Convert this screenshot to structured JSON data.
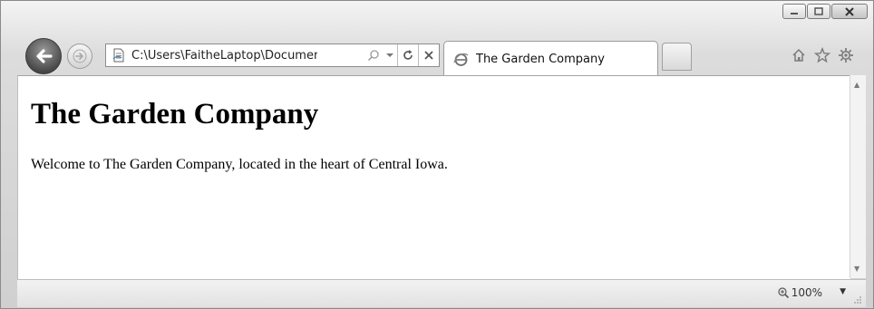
{
  "window": {
    "caption_buttons": [
      "minimize",
      "maximize",
      "close"
    ]
  },
  "nav": {
    "back_icon": "back-arrow-icon",
    "forward_icon": "forward-arrow-icon"
  },
  "address_bar": {
    "url": "C:\\Users\\FaitheLaptop\\Documents\\N",
    "icons": [
      "page-icon",
      "search-icon",
      "dropdown-icon",
      "refresh-icon",
      "stop-icon"
    ]
  },
  "tab": {
    "label": "The Garden Company",
    "icon": "ie-page-icon"
  },
  "toolbar_right": {
    "icons": [
      "home-icon",
      "favorites-star-icon",
      "settings-gear-icon"
    ]
  },
  "page": {
    "heading": "The Garden Company",
    "paragraph": "Welcome to The Garden Company, located in the heart of Central Iowa."
  },
  "status_bar": {
    "zoom": "100%"
  },
  "colors": {
    "chrome_bg": "#dcdcdc",
    "back_button": "#4a4a4a",
    "content_bg": "#ffffff"
  }
}
